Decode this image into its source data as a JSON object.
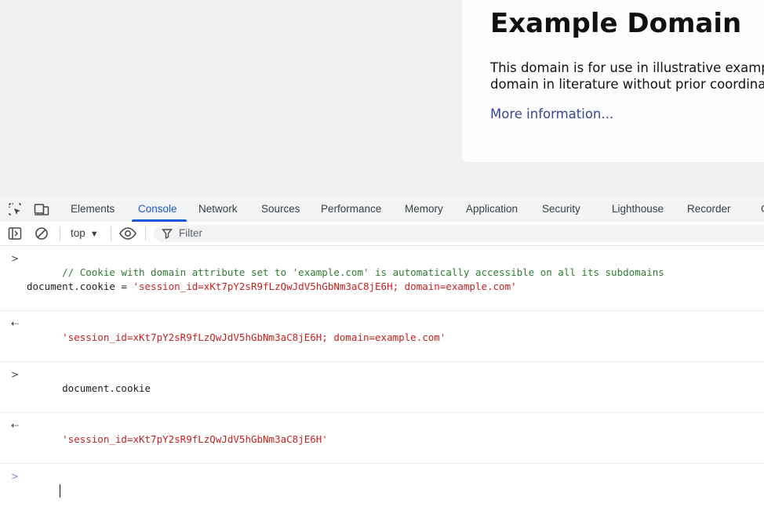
{
  "page": {
    "title": "Example Domain",
    "paragraph_line1": "This domain is for use in illustrative examples",
    "paragraph_line2": "domain in literature without prior coordinatio",
    "link": "More information..."
  },
  "devtools": {
    "tabs": [
      {
        "label": "Elements"
      },
      {
        "label": "Console",
        "active": true
      },
      {
        "label": "Network"
      },
      {
        "label": "Sources"
      },
      {
        "label": "Performance"
      },
      {
        "label": "Memory"
      },
      {
        "label": "Application"
      },
      {
        "label": "Security"
      },
      {
        "label": "Lighthouse"
      },
      {
        "label": "Recorder"
      },
      {
        "label": "C"
      }
    ],
    "toolbar": {
      "context": "top",
      "filter_placeholder": "Filter"
    },
    "console": {
      "entry1_comment": "// Cookie with domain attribute set to 'example.com' is automatically accessible on all its subdomains",
      "entry1_code": "document.cookie = ",
      "entry1_string": "'session_id=xKt7pY2sR9fLzQwJdV5hGbNm3aC8jE6H; domain=example.com'",
      "result1": "'session_id=xKt7pY2sR9fLzQwJdV5hGbNm3aC8jE6H; domain=example.com'",
      "entry2_code": "document.cookie",
      "result2": "'session_id=xKt7pY2sR9fLzQwJdV5hGbNm3aC8jE6H'"
    }
  },
  "colors": {
    "accent": "#1a57d6",
    "string": "#c5221f",
    "comment": "#2e7d32",
    "link": "#38488f"
  }
}
